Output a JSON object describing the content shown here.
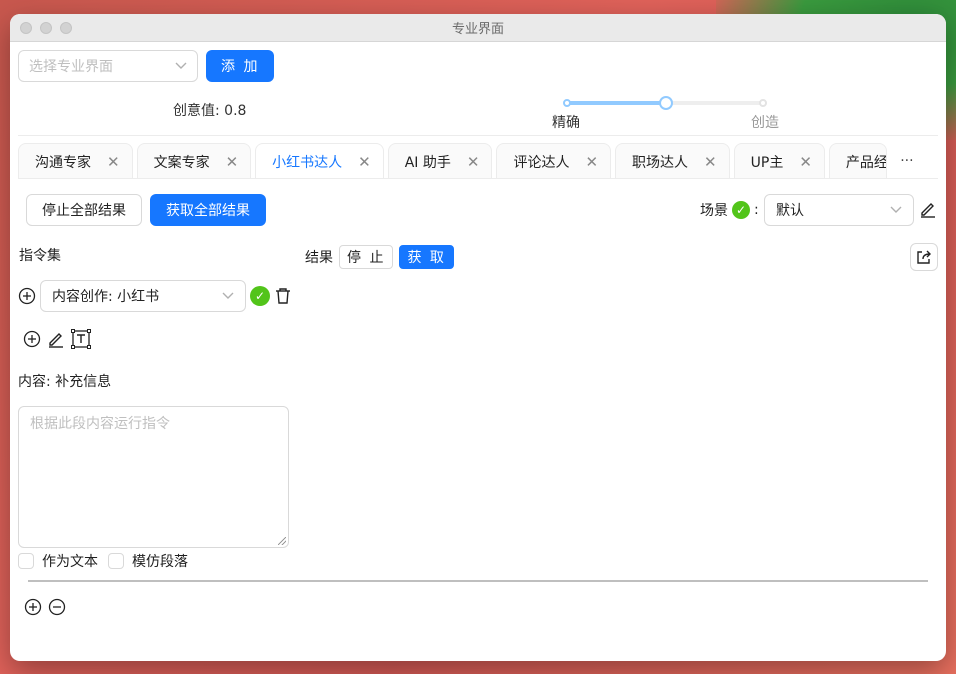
{
  "window": {
    "title": "专业界面"
  },
  "top": {
    "select_placeholder": "选择专业界面",
    "add_label": "添 加",
    "creativity_label": "创意值: 0.8",
    "creativity_value": 0.8,
    "slider_marks": {
      "left": "精确",
      "right": "创造"
    }
  },
  "tabs": [
    {
      "label": "沟通专家"
    },
    {
      "label": "文案专家"
    },
    {
      "label": "小红书达人",
      "active": true
    },
    {
      "label": "AI 助手"
    },
    {
      "label": "评论达人"
    },
    {
      "label": "职场达人"
    },
    {
      "label": "UP主"
    },
    {
      "label": "产品经"
    }
  ],
  "tab_more": "···",
  "actions": {
    "stop_all": "停止全部结果",
    "get_all": "获取全部结果",
    "scene_label": "场景",
    "scene_colon": ":",
    "scene_value": "默认"
  },
  "instructions": {
    "label": "指令集",
    "command_value": "内容创作: 小红书",
    "content_label": "内容: 补充信息",
    "textarea_placeholder": "根据此段内容运行指令",
    "as_text": "作为文本",
    "imitate": "模仿段落"
  },
  "result": {
    "label": "结果",
    "stop": "停 止",
    "get": "获 取"
  },
  "colors": {
    "primary": "#1677ff",
    "success": "#52c41a"
  },
  "icons": [
    "plus-circle-icon",
    "edit-icon",
    "text-box-icon",
    "delete-icon",
    "share-icon",
    "minus-circle-icon",
    "chevron-down-icon",
    "close-icon",
    "check-circle-icon"
  ]
}
